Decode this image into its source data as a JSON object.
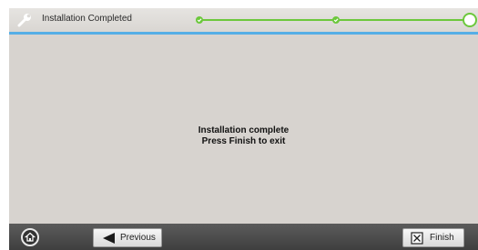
{
  "header": {
    "title": "Installation Completed",
    "steps": [
      {
        "state": "done"
      },
      {
        "state": "done"
      },
      {
        "state": "current"
      }
    ],
    "accent_color": "#55aee6",
    "progress_color": "#6cc83c"
  },
  "main": {
    "message_line1": "Installation complete",
    "message_line2": "Press Finish to exit"
  },
  "footer": {
    "home_icon": "home-icon",
    "previous_label": "Previous",
    "finish_label": "Finish"
  }
}
